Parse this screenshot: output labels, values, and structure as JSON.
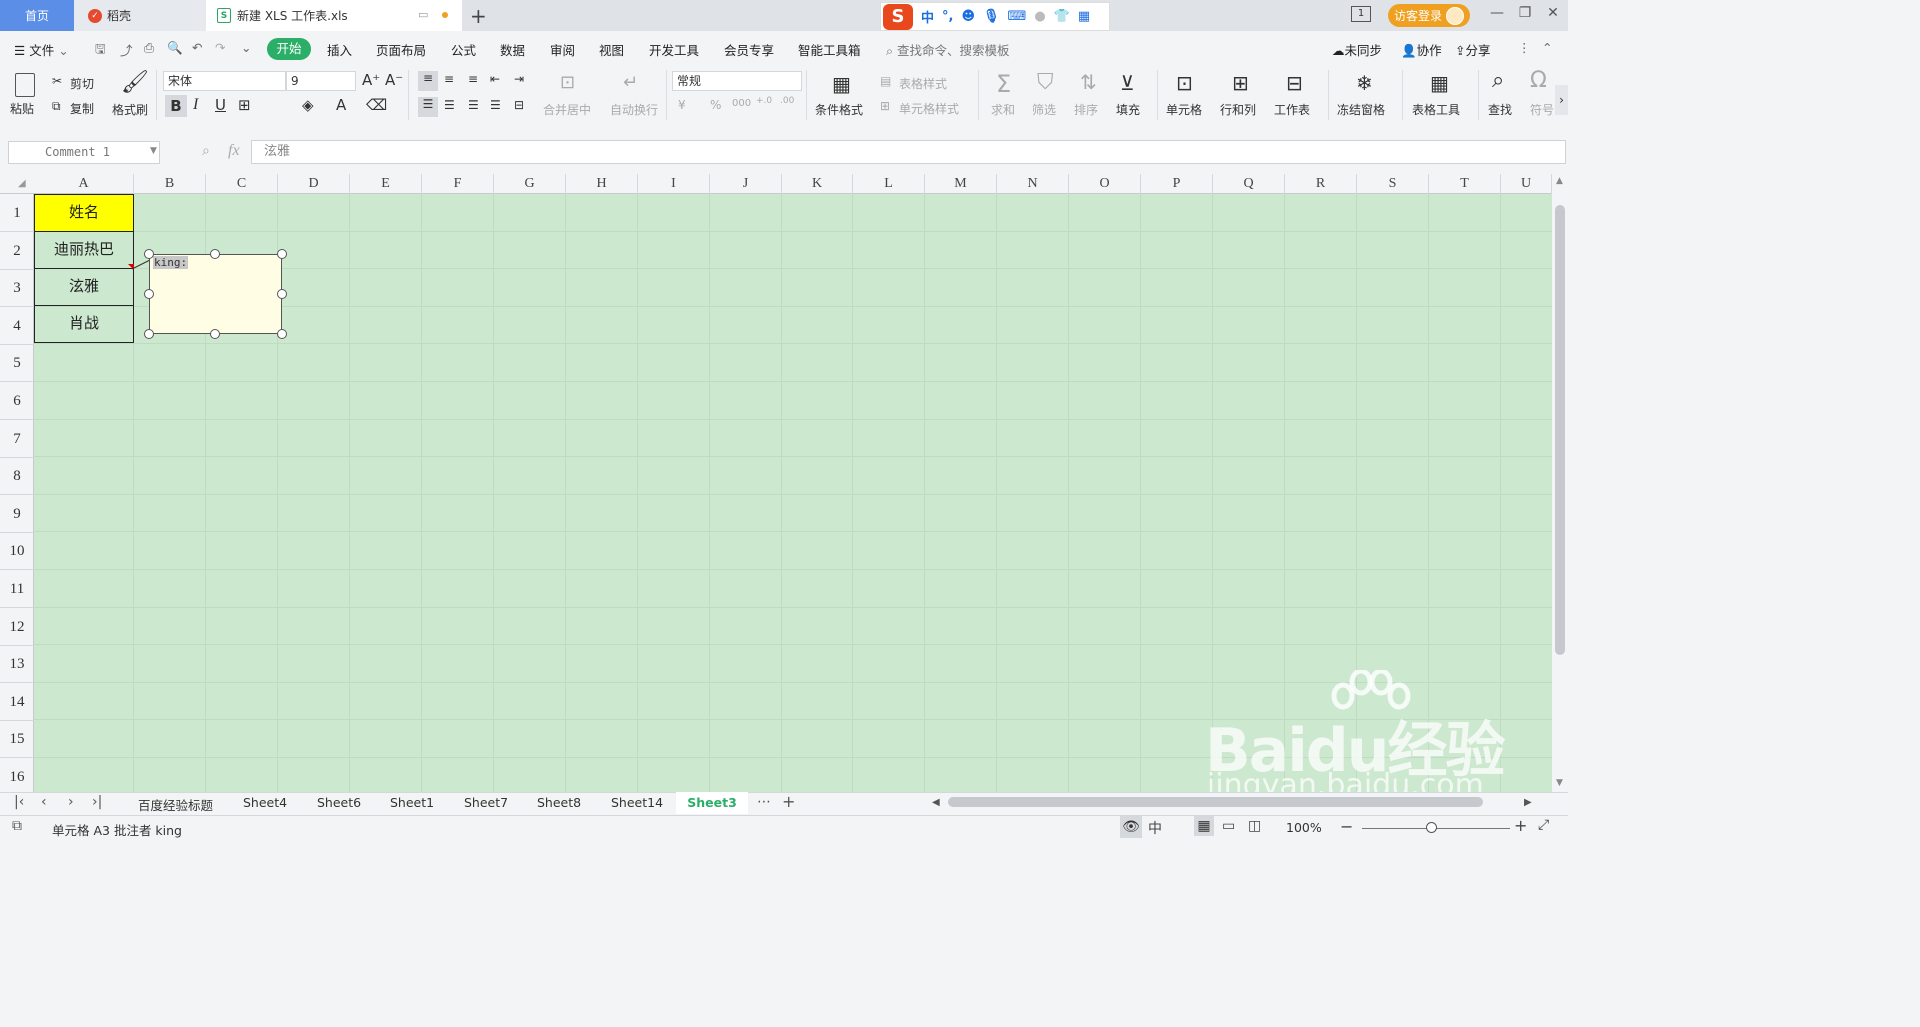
{
  "tabs": {
    "home": "首页",
    "docer": "稻壳",
    "file": "新建 XLS 工作表.xls",
    "add": "+"
  },
  "ime": {
    "logo": "S",
    "mode": "中",
    "punct": "°,"
  },
  "top_right": {
    "login": "访客登录",
    "page_indicator": "1"
  },
  "menu": {
    "file": "文件",
    "items": [
      "开始",
      "插入",
      "页面布局",
      "公式",
      "数据",
      "审阅",
      "视图",
      "开发工具",
      "会员专享",
      "智能工具箱"
    ],
    "search_placeholder": "查找命令、搜索模板",
    "unsynced": "未同步",
    "collab": "协作",
    "share": "分享"
  },
  "ribbon": {
    "paste": "粘贴",
    "cut": "剪切",
    "copy": "复制",
    "format_painter": "格式刷",
    "font_name": "宋体",
    "font_size": "9",
    "merge_center": "合并居中",
    "wrap": "自动换行",
    "number_format": "常规",
    "cond_format": "条件格式",
    "table_style": "表格样式",
    "cell_style": "单元格样式",
    "sum": "求和",
    "filter": "筛选",
    "sort": "排序",
    "fill": "填充",
    "cell": "单元格",
    "rowcol": "行和列",
    "worksheet": "工作表",
    "freeze": "冻结窗格",
    "table_tools": "表格工具",
    "find": "查找",
    "symbol": "符号"
  },
  "formula_bar": {
    "name_box": "Comment 1",
    "fx": "fx",
    "value": "泫雅"
  },
  "columns": [
    "A",
    "B",
    "C",
    "D",
    "E",
    "F",
    "G",
    "H",
    "I",
    "J",
    "K",
    "L",
    "M",
    "N",
    "O",
    "P",
    "Q",
    "R",
    "S",
    "T",
    "U"
  ],
  "rows": [
    "1",
    "2",
    "3",
    "4",
    "5",
    "6",
    "7",
    "8",
    "9",
    "10",
    "11",
    "12",
    "13",
    "14",
    "15",
    "16"
  ],
  "cells": {
    "A1": "姓名",
    "A2": "迪丽热巴",
    "A3": "泫雅",
    "A4": "肖战"
  },
  "colors": {
    "header_fill": "#ffff00",
    "grid_bg": "#cce8cf",
    "accent": "#2bae68"
  },
  "comment": {
    "author": "king:"
  },
  "sheets": [
    "百度经验标题",
    "Sheet4",
    "Sheet6",
    "Sheet1",
    "Sheet7",
    "Sheet8",
    "Sheet14",
    "Sheet3"
  ],
  "active_sheet": "Sheet3",
  "status": {
    "text": "单元格 A3 批注者 king",
    "zoom": "100%"
  },
  "watermark": {
    "main": "Baidu经验",
    "url": "jingyan.baidu.com"
  }
}
